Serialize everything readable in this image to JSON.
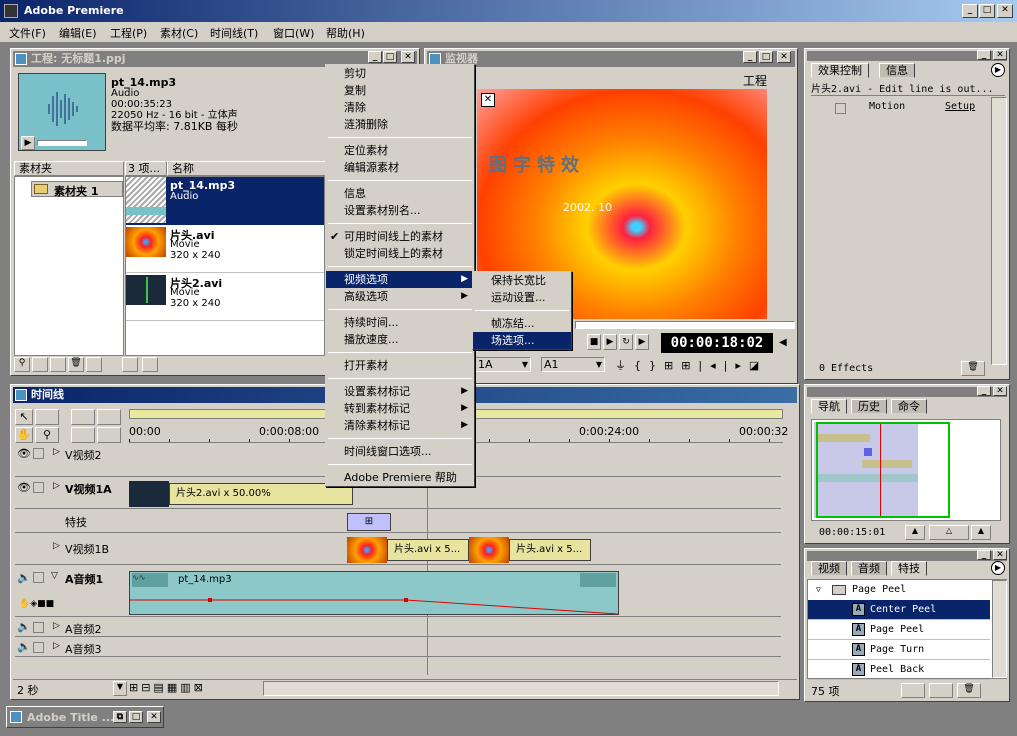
{
  "app": {
    "title": "Adobe Premiere",
    "min": "_",
    "max": "□",
    "close": "✕"
  },
  "menubar": [
    "文件(F)",
    "编辑(E)",
    "工程(P)",
    "素材(C)",
    "时间线(T)",
    "窗口(W)",
    "帮助(H)"
  ],
  "project": {
    "title": "工程: 无标题1.ppj",
    "preview": {
      "name": "pt_14.mp3",
      "type": "Audio",
      "duration": "00:00:35:23",
      "format": "22050 Hz - 16 bit - 立体声",
      "rate": "数据平均率: 7.81KB 每秒"
    },
    "bins_header": "素材夹",
    "items_count": "3 项...",
    "name_header": "名称",
    "bin": "素材夹 1",
    "items": [
      {
        "name": "pt_14.mp3",
        "type": "Audio",
        "size": ""
      },
      {
        "name": "片头.avi",
        "type": "Movie",
        "size": "320 x 240"
      },
      {
        "name": "片头2.avi",
        "type": "Movie",
        "size": "320 x 240"
      }
    ]
  },
  "monitor": {
    "title": "监视器",
    "tab": "工程",
    "timecode": "00:00:18:02",
    "track_a": "1A",
    "track_b": "A1",
    "image_text": "2002. 10",
    "image_title": "图字特效"
  },
  "context_menu": {
    "items": [
      {
        "label": "剪切"
      },
      {
        "label": "复制"
      },
      {
        "label": "清除"
      },
      {
        "label": "涟漪删除"
      },
      {
        "sep": true
      },
      {
        "label": "定位素材"
      },
      {
        "label": "编辑源素材"
      },
      {
        "sep": true
      },
      {
        "label": "信息"
      },
      {
        "label": "设置素材别名..."
      },
      {
        "sep": true
      },
      {
        "label": "可用时间线上的素材",
        "check": "✔"
      },
      {
        "label": "锁定时间线上的素材"
      },
      {
        "sep": true
      },
      {
        "label": "视频选项",
        "sub": "▶",
        "hl": true
      },
      {
        "label": "高级选项",
        "sub": "▶"
      },
      {
        "sep": true
      },
      {
        "label": "持续时间..."
      },
      {
        "label": "播放速度..."
      },
      {
        "sep": true
      },
      {
        "label": "打开素材"
      },
      {
        "sep": true
      },
      {
        "label": "设置素材标记",
        "sub": "▶"
      },
      {
        "label": "转到素材标记",
        "sub": "▶"
      },
      {
        "label": "清除素材标记",
        "sub": "▶"
      },
      {
        "sep": true
      },
      {
        "label": "时间线窗口选项..."
      },
      {
        "sep": true
      },
      {
        "label": "Adobe Premiere 帮助"
      }
    ]
  },
  "submenu": {
    "items": [
      {
        "label": "保持长宽比"
      },
      {
        "label": "运动设置..."
      },
      {
        "sep": true
      },
      {
        "label": "帧冻结..."
      },
      {
        "label": "场选项...",
        "hl": true
      }
    ]
  },
  "timeline": {
    "title": "时间线",
    "time_labels": [
      "00:00",
      "0:00:08:00",
      "0:00:24:00",
      "00:00:32"
    ],
    "tracks": [
      "V视频2",
      "V视频1A",
      "特技",
      "V视频1B",
      "A音频1",
      "A音频2",
      "A音频3"
    ],
    "clips": {
      "v1a": "片头2.avi x 50.00%",
      "v1b_1": "片头.avi x 5...",
      "v1b_2": "片头.avi x 5...",
      "audio": "pt_14.mp3"
    },
    "zoom": "2 秒"
  },
  "effects": {
    "tabs": [
      "效果控制",
      "信息"
    ],
    "header": "片头2.avi - Edit line is out...",
    "motion": "Motion",
    "setup": "Setup",
    "count": "0 Effects"
  },
  "navigator": {
    "tabs": [
      "导航",
      "历史",
      "命令"
    ],
    "timecode": "00:00:15:01"
  },
  "transitions": {
    "tabs": [
      "视频",
      "音频",
      "特技"
    ],
    "folder": "Page Peel",
    "items": [
      "Center Peel",
      "Page Peel",
      "Page Turn",
      "Peel Back"
    ],
    "count": "75 项"
  },
  "taskbar": {
    "title": "Adobe Title ..."
  }
}
